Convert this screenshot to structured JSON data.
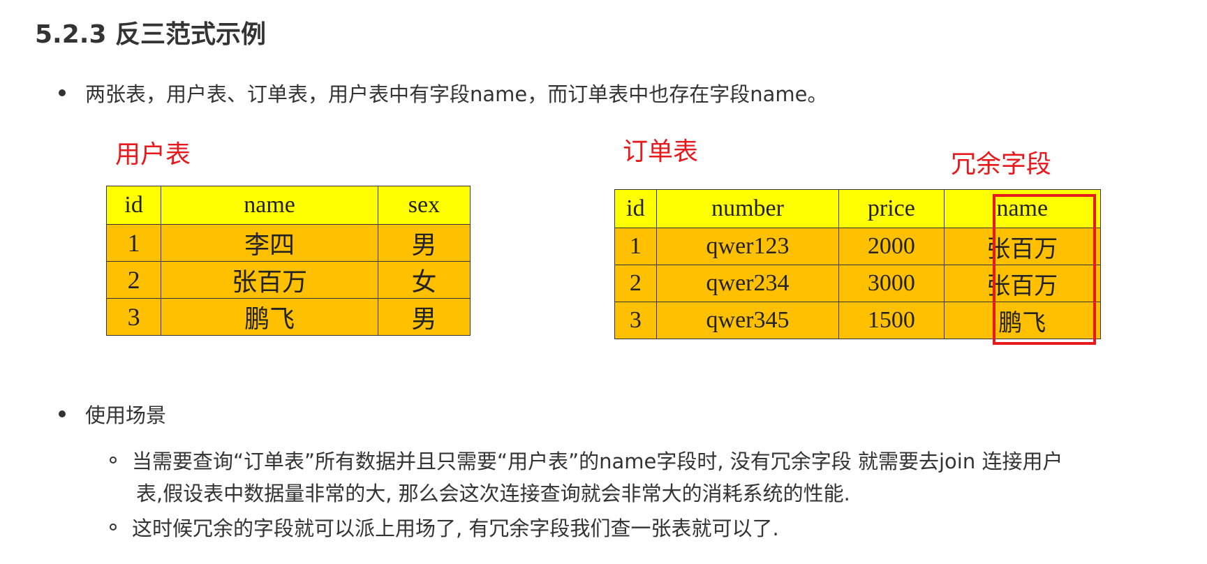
{
  "heading": "5.2.3 反三范式示例",
  "bullet1": "两张表，用户表、订单表，用户表中有字段name，而订单表中也存在字段name。",
  "user_table": {
    "label": "用户表",
    "headers": [
      "id",
      "name",
      "sex"
    ],
    "rows": [
      [
        "1",
        "李四",
        "男"
      ],
      [
        "2",
        "张百万",
        "女"
      ],
      [
        "3",
        "鹏飞",
        "男"
      ]
    ]
  },
  "order_table": {
    "label": "订单表",
    "redundant_label": "冗余字段",
    "headers": [
      "id",
      "number",
      "price",
      "name"
    ],
    "rows": [
      [
        "1",
        "qwer123",
        "2000",
        "张百万"
      ],
      [
        "2",
        "qwer234",
        "3000",
        "张百万"
      ],
      [
        "3",
        "qwer345",
        "1500",
        "鹏飞"
      ]
    ]
  },
  "bullet2": "使用场景",
  "sub1_line1": "当需要查询“订单表”所有数据并且只需要“用户表”的name字段时, 没有冗余字段 就需要去join 连接用户",
  "sub1_line2": "表,假设表中数据量非常的大, 那么会这次连接查询就会非常大的消耗系统的性能.",
  "sub2": "这时候冗余的字段就可以派上用场了, 有冗余字段我们查一张表就可以了.",
  "colors": {
    "header": "#ffff00",
    "cell": "#ffc000",
    "red": "#e8191c"
  }
}
